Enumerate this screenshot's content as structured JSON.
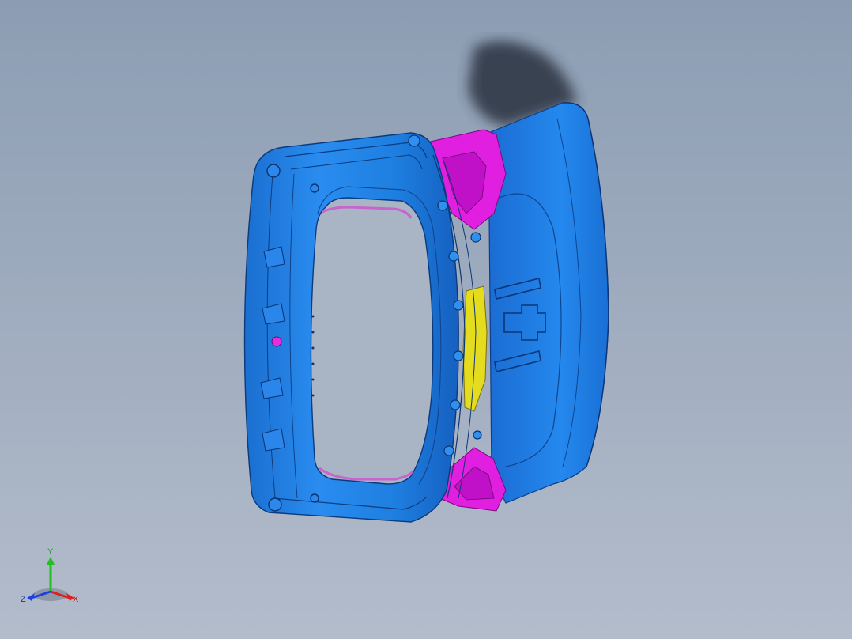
{
  "viewport": {
    "background_top": "#8c9db3",
    "background_bottom": "#b3bccb"
  },
  "model": {
    "colors": {
      "main_body": "#1e7fe0",
      "main_body_dark": "#1565c0",
      "main_body_light": "#3a9af2",
      "bracket": "#e020e0",
      "insert": "#e8e020"
    }
  },
  "triad": {
    "x_label": "X",
    "y_label": "Y",
    "z_label": "Z",
    "x_color": "#e02020",
    "y_color": "#20c020",
    "z_color": "#2040e0"
  }
}
